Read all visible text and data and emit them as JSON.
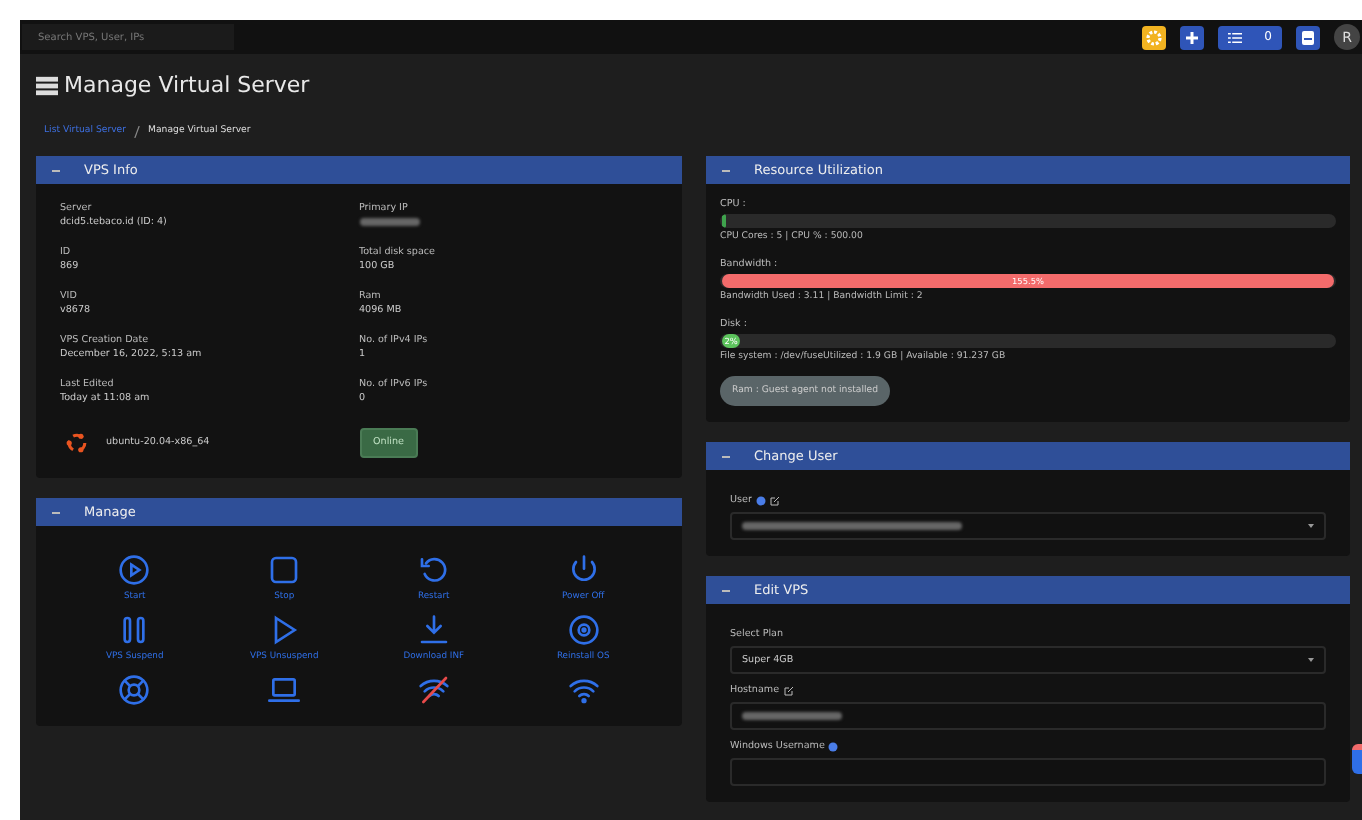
{
  "search": {
    "placeholder": "Search VPS, User, IPs"
  },
  "toolbar": {
    "task_count": "0",
    "avatar": "R"
  },
  "page_title": "Manage Virtual Server",
  "breadcrumb": [
    {
      "label": "List Virtual Server",
      "link": true
    },
    {
      "label": "Manage Virtual Server",
      "link": false
    }
  ],
  "vps_info": {
    "title": "VPS Info",
    "fields": [
      {
        "label": "Server",
        "value": "dcid5.tebaco.id (ID: 4)",
        "redacted": false
      },
      {
        "label": "Primary IP",
        "redacted": true
      },
      {
        "label": "ID",
        "value": "869",
        "redacted": false
      },
      {
        "label": "Total disk space",
        "value": "100 GB",
        "redacted": false
      },
      {
        "label": "VID",
        "value": "v8678",
        "redacted": false
      },
      {
        "label": "Ram",
        "value": "4096 MB",
        "redacted": false
      },
      {
        "label": "VPS Creation Date",
        "value": "December 16, 2022, 5:13 am",
        "redacted": false
      },
      {
        "label": "No. of IPv4 IPs",
        "value": "1",
        "redacted": false
      },
      {
        "label": "Last Edited",
        "value": "Today at 11:08 am",
        "redacted": false
      },
      {
        "label": "No. of IPv6 IPs",
        "value": "0",
        "redacted": false
      }
    ],
    "os": "ubuntu-20.04-x86_64",
    "status": "Online"
  },
  "manage": {
    "title": "Manage",
    "actions": [
      {
        "kind": "start",
        "label": "Start"
      },
      {
        "kind": "stop",
        "label": "Stop"
      },
      {
        "kind": "restart",
        "label": "Restart"
      },
      {
        "kind": "poweroff",
        "label": "Power Off"
      },
      {
        "kind": "suspend",
        "label": "VPS Suspend"
      },
      {
        "kind": "unsuspend",
        "label": "VPS Unsuspend"
      },
      {
        "kind": "download",
        "label": "Download INF"
      },
      {
        "kind": "reinstall",
        "label": "Reinstall OS"
      },
      {
        "kind": "rescue"
      },
      {
        "kind": "console"
      },
      {
        "kind": "disconnect"
      },
      {
        "kind": "connect"
      }
    ]
  },
  "resources": {
    "title": "Resource Utilization",
    "meters": [
      {
        "label": "CPU :",
        "level": 0.005,
        "color": "#3fa34d",
        "detail": "CPU Cores : 5  |  CPU % : 500.00"
      },
      {
        "label": "Bandwidth :",
        "level": 1,
        "color": "#f36b6b",
        "bar_text": "155.5%",
        "detail": "Bandwidth Used : 3.11  |  Bandwidth Limit : 2"
      },
      {
        "label": "Disk :",
        "level": 0.03,
        "color": "#5cc35c",
        "bar_text": "2%",
        "detail": "File system : /dev/fuseUtilized : 1.9 GB  |  Available : 91.237 GB"
      }
    ],
    "ram_badge": "Ram : Guest agent not installed"
  },
  "change_user": {
    "title": "Change User",
    "label": "User",
    "redacted": true
  },
  "edit_vps": {
    "title": "Edit VPS",
    "fields": [
      {
        "kind": "select",
        "label": "Select Plan",
        "value": "Super 4GB",
        "info": false,
        "edit": false,
        "redacted": false
      },
      {
        "kind": "input",
        "label": "Hostname",
        "info": false,
        "edit": true,
        "redacted": true
      },
      {
        "kind": "input",
        "label": "Windows Username",
        "info": true,
        "edit": false,
        "redacted": false
      }
    ]
  }
}
